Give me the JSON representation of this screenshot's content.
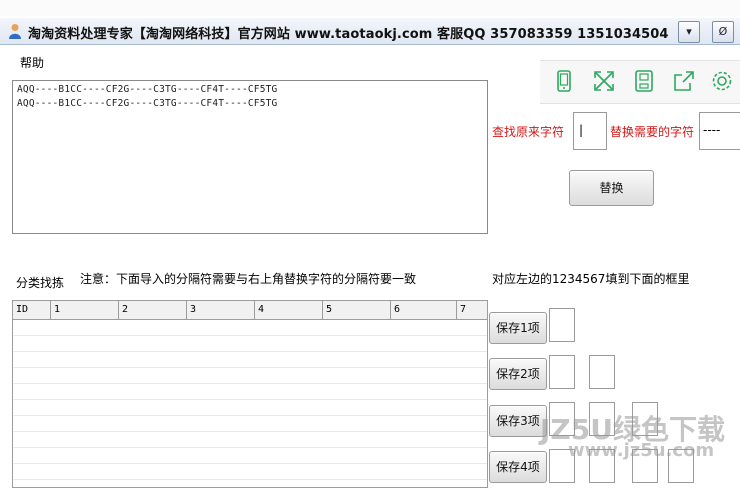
{
  "window": {
    "title": "淘淘资料处理专家【淘淘网络科技】官方网站 www.taotaokj.com 客服QQ 357083359 1351034504",
    "buttons": [
      "▾",
      "Ø"
    ]
  },
  "menu": {
    "help": "帮助"
  },
  "textarea": {
    "lines": [
      "AQQ----B1CC----CF2G----C3TG----CF4T----CF5TG",
      "AQQ----B1CC----CF2G----C3TG----CF4T----CF5TG"
    ]
  },
  "toolbar": {
    "icons": [
      "phone-icon",
      "expand-icon",
      "save-icon",
      "share-icon",
      "settings-icon"
    ]
  },
  "replace": {
    "find_label": "查找原来字符",
    "find_value": "|",
    "replace_label": "替换需要的字符",
    "replace_value": "----",
    "button": "替换"
  },
  "classify": {
    "label": "分类找拣",
    "note": "注意：下面导入的分隔符需要与右上角替换字符的分隔符要一致",
    "right_note": "对应左边的1234567填到下面的框里"
  },
  "grid": {
    "columns": [
      "ID",
      "1",
      "2",
      "3",
      "4",
      "5",
      "6",
      "7"
    ]
  },
  "save_buttons": [
    "保存1项",
    "保存2项",
    "保存3项",
    "保存4项"
  ],
  "watermark": {
    "brand": "JZ5U绿色下载",
    "url": "www.jz5u.com"
  }
}
